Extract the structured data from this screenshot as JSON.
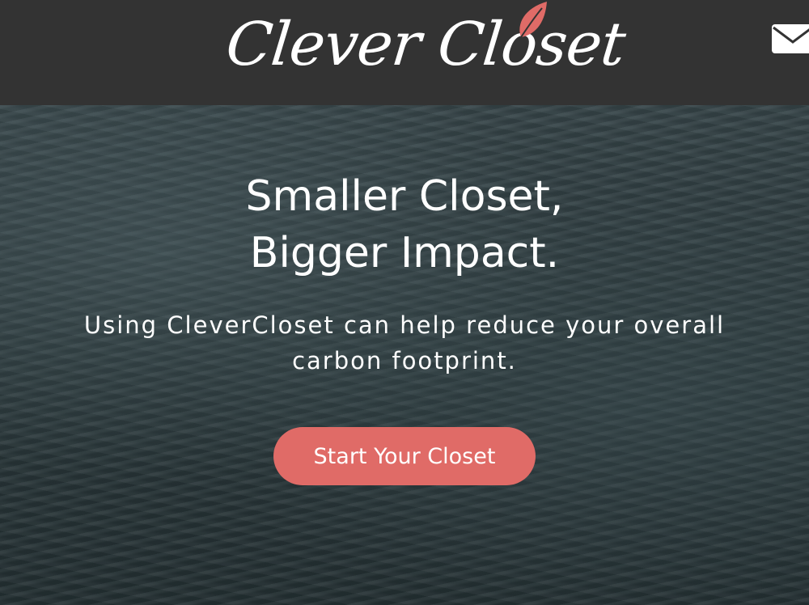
{
  "header": {
    "logo_text": "Clever Closet",
    "contact_icon": "envelope-icon"
  },
  "hero": {
    "title_line1": "Smaller Closet,",
    "title_line2": "Bigger Impact.",
    "subtitle": "Using CleverCloset can help reduce your overall carbon footprint.",
    "cta_label": "Start Your Closet"
  },
  "colors": {
    "header_bg": "#333333",
    "accent": "#e06b67",
    "text": "#ffffff"
  }
}
